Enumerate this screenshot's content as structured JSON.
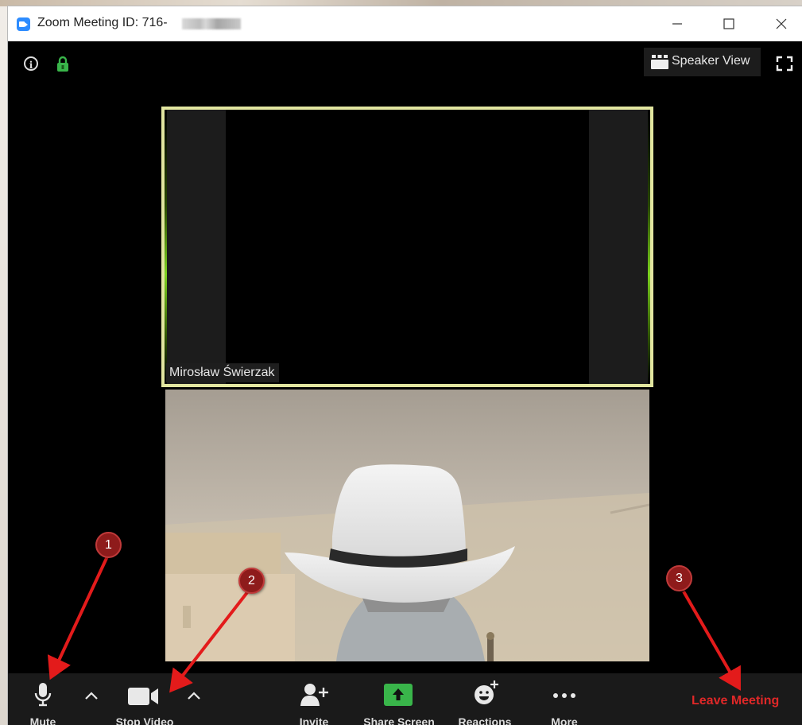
{
  "window": {
    "title": "Zoom Meeting ID: 716-"
  },
  "controls": {
    "minimize": "—",
    "maximize": "☐",
    "close": "✕"
  },
  "top": {
    "info_icon": "i",
    "speaker_view_label": "Speaker View"
  },
  "participants": [
    {
      "name": "Mirosław Świerzak",
      "active_speaker": true,
      "video_on": false
    },
    {
      "name": "",
      "video_on": true
    }
  ],
  "toolbar": {
    "mute": "Mute",
    "stop_video": "Stop Video",
    "invite": "Invite",
    "share_screen": "Share Screen",
    "reactions": "Reactions",
    "more": "More",
    "leave": "Leave Meeting"
  },
  "annotations": [
    "1",
    "2",
    "3"
  ],
  "colors": {
    "accent_blue": "#2d8cff",
    "active_border": "#e2e6a0",
    "share_green": "#39b54a",
    "leave_red": "#e02828",
    "badge_red": "#8e1b1b"
  }
}
